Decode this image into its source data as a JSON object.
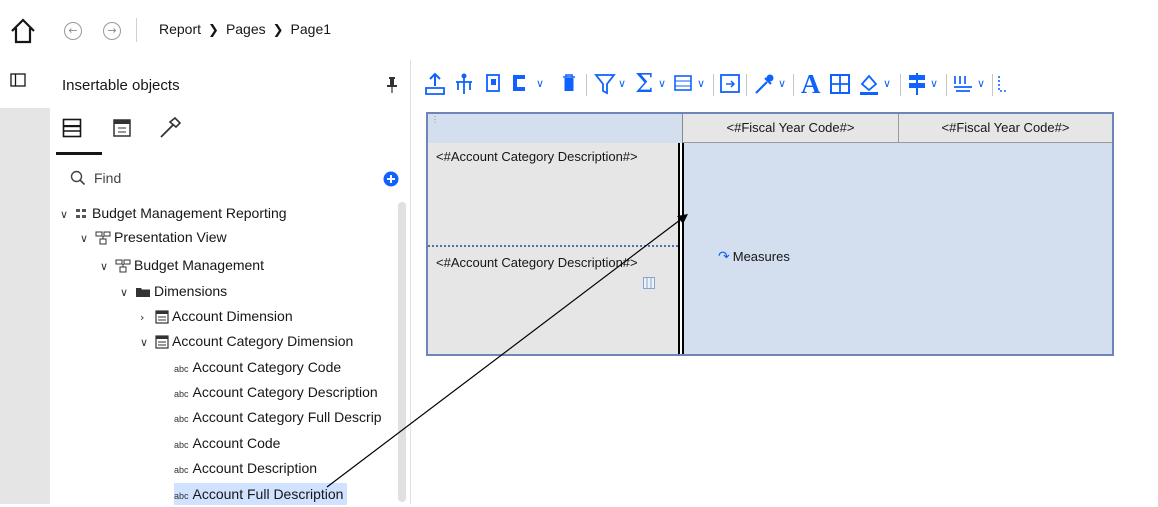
{
  "breadcrumb": [
    "Report",
    "Pages",
    "Page1"
  ],
  "panel": {
    "title": "Insertable objects",
    "find_placeholder": "Find"
  },
  "tree": [
    {
      "label": "Budget Management Reporting",
      "icon": "package-icon",
      "expanded": true
    },
    {
      "label": "Presentation View",
      "icon": "namespace-icon",
      "expanded": true
    },
    {
      "label": "Budget Management",
      "icon": "namespace-icon",
      "expanded": true
    },
    {
      "label": "Dimensions",
      "icon": "folder-icon",
      "expanded": true
    },
    {
      "label": "Account Dimension",
      "icon": "query-subject-icon",
      "expanded": false
    },
    {
      "label": "Account Category Dimension",
      "icon": "query-subject-icon",
      "expanded": true
    },
    {
      "label": "Account Category Code",
      "icon": "abc-icon"
    },
    {
      "label": "Account Category Description",
      "icon": "abc-icon"
    },
    {
      "label": "Account Category Full Descrip",
      "icon": "abc-icon"
    },
    {
      "label": "Account Code",
      "icon": "abc-icon"
    },
    {
      "label": "Account Description",
      "icon": "abc-icon"
    },
    {
      "label": "Account Full Description",
      "icon": "abc-icon",
      "selected": true
    }
  ],
  "abc_glyph": "abc",
  "crosstab": {
    "col_header_1": "<#Fiscal Year Code#>",
    "col_header_2": "<#Fiscal Year Code#>",
    "row_header_1": "<#Account Category Description#>",
    "row_header_2": "<#Account Category Description#>",
    "measures_label": "Measures"
  },
  "colors": {
    "accent": "#0f62fe",
    "crosstab_fill": "#d3deee",
    "header_fill": "#e8e8e8",
    "selection": "#d0e2ff"
  }
}
